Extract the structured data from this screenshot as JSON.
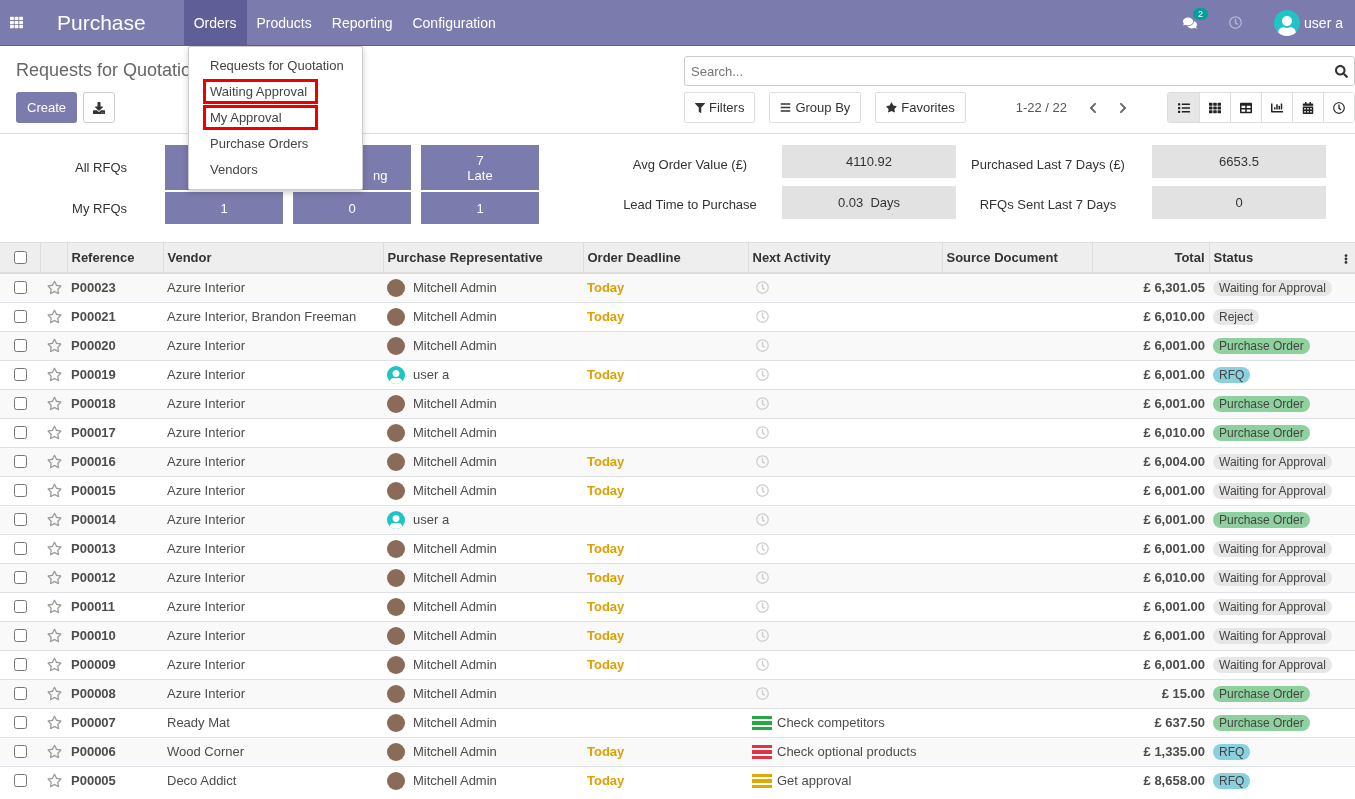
{
  "navbar": {
    "app_title": "Purchase",
    "menu": [
      {
        "label": "Orders",
        "selected": true
      },
      {
        "label": "Products",
        "selected": false
      },
      {
        "label": "Reporting",
        "selected": false
      },
      {
        "label": "Configuration",
        "selected": false
      }
    ],
    "messages_count": "2",
    "user": "user a"
  },
  "orders_menu": [
    {
      "label": "Requests for Quotation",
      "highlighted": false
    },
    {
      "label": "Waiting Approval",
      "highlighted": true
    },
    {
      "label": "My Approval",
      "highlighted": true
    },
    {
      "label": "Purchase Orders",
      "highlighted": false
    },
    {
      "label": "Vendors",
      "highlighted": false
    }
  ],
  "control_panel": {
    "title": "Requests for Quotatio",
    "create": "Create",
    "search": {
      "placeholder": "Search..."
    },
    "filters": "Filters",
    "group_by": "Group By",
    "favorites": "Favorites",
    "pager": "1-22 / 22",
    "views": [
      {
        "kind": "list",
        "selected": true
      },
      {
        "kind": "kanban",
        "selected": false
      },
      {
        "kind": "pivot",
        "selected": false
      },
      {
        "kind": "graph",
        "selected": false
      },
      {
        "kind": "calendar",
        "selected": false
      },
      {
        "kind": "activity",
        "selected": false
      }
    ]
  },
  "dashboard": {
    "row_labels": [
      "All RFQs",
      "My RFQs"
    ],
    "top_tiles": [
      {
        "label": "ng"
      },
      {
        "value": "7",
        "label": "Late"
      }
    ],
    "bottom_tiles": [
      "1",
      "0",
      "1"
    ],
    "stats": [
      {
        "label": "Avg Order Value (£)",
        "value": "4110.92"
      },
      {
        "label": "Purchased Last 7 Days (£)",
        "value": "6653.5"
      },
      {
        "label": "Lead Time to Purchase",
        "value": "0.03  Days"
      },
      {
        "label": "RFQs Sent Last 7 Days",
        "value": "0"
      }
    ]
  },
  "table": {
    "select_all_checked": false,
    "columns": [
      "Reference",
      "Vendor",
      "Purchase Representative",
      "Order Deadline",
      "Next Activity",
      "Source Document",
      "Total",
      "Status"
    ],
    "rows": [
      {
        "checked": false,
        "reference": "P00023",
        "vendor": "Azure Interior",
        "rep": {
          "name": "Mitchell Admin",
          "kind": "photo"
        },
        "deadline": "Today",
        "total": "£ 6,301.05",
        "status": {
          "label": "Waiting for Approval",
          "color": "#e6e6e6"
        }
      },
      {
        "checked": false,
        "reference": "P00021",
        "vendor": "Azure Interior, Brandon Freeman",
        "rep": {
          "name": "Mitchell Admin",
          "kind": "photo"
        },
        "deadline": "Today",
        "total": "£ 6,010.00",
        "status": {
          "label": "Reject",
          "color": "#e6e6e6"
        }
      },
      {
        "checked": false,
        "reference": "P00020",
        "vendor": "Azure Interior",
        "rep": {
          "name": "Mitchell Admin",
          "kind": "photo"
        },
        "total": "£ 6,001.00",
        "status": {
          "label": "Purchase Order",
          "color": "#8fd19e"
        }
      },
      {
        "checked": false,
        "reference": "P00019",
        "vendor": "Azure Interior",
        "rep": {
          "name": "user a",
          "kind": "user"
        },
        "deadline": "Today",
        "total": "£ 6,001.00",
        "status": {
          "label": "RFQ",
          "color": "#8ad0df"
        }
      },
      {
        "checked": false,
        "reference": "P00018",
        "vendor": "Azure Interior",
        "rep": {
          "name": "Mitchell Admin",
          "kind": "photo"
        },
        "total": "£ 6,001.00",
        "status": {
          "label": "Purchase Order",
          "color": "#8fd19e"
        }
      },
      {
        "checked": false,
        "reference": "P00017",
        "vendor": "Azure Interior",
        "rep": {
          "name": "Mitchell Admin",
          "kind": "photo"
        },
        "total": "£ 6,010.00",
        "status": {
          "label": "Purchase Order",
          "color": "#8fd19e"
        }
      },
      {
        "checked": false,
        "reference": "P00016",
        "vendor": "Azure Interior",
        "rep": {
          "name": "Mitchell Admin",
          "kind": "photo"
        },
        "deadline": "Today",
        "total": "£ 6,004.00",
        "status": {
          "label": "Waiting for Approval",
          "color": "#e6e6e6"
        }
      },
      {
        "checked": false,
        "reference": "P00015",
        "vendor": "Azure Interior",
        "rep": {
          "name": "Mitchell Admin",
          "kind": "photo"
        },
        "deadline": "Today",
        "total": "£ 6,001.00",
        "status": {
          "label": "Waiting for Approval",
          "color": "#e6e6e6"
        }
      },
      {
        "checked": false,
        "reference": "P00014",
        "vendor": "Azure Interior",
        "rep": {
          "name": "user a",
          "kind": "user"
        },
        "total": "£ 6,001.00",
        "status": {
          "label": "Purchase Order",
          "color": "#8fd19e"
        }
      },
      {
        "checked": false,
        "reference": "P00013",
        "vendor": "Azure Interior",
        "rep": {
          "name": "Mitchell Admin",
          "kind": "photo"
        },
        "deadline": "Today",
        "total": "£ 6,001.00",
        "status": {
          "label": "Waiting for Approval",
          "color": "#e6e6e6"
        }
      },
      {
        "checked": false,
        "reference": "P00012",
        "vendor": "Azure Interior",
        "rep": {
          "name": "Mitchell Admin",
          "kind": "photo"
        },
        "deadline": "Today",
        "total": "£ 6,010.00",
        "status": {
          "label": "Waiting for Approval",
          "color": "#e6e6e6"
        }
      },
      {
        "checked": false,
        "reference": "P00011",
        "vendor": "Azure Interior",
        "rep": {
          "name": "Mitchell Admin",
          "kind": "photo"
        },
        "deadline": "Today",
        "total": "£ 6,001.00",
        "status": {
          "label": "Waiting for Approval",
          "color": "#e6e6e6"
        }
      },
      {
        "checked": false,
        "reference": "P00010",
        "vendor": "Azure Interior",
        "rep": {
          "name": "Mitchell Admin",
          "kind": "photo"
        },
        "deadline": "Today",
        "total": "£ 6,001.00",
        "status": {
          "label": "Waiting for Approval",
          "color": "#e6e6e6"
        }
      },
      {
        "checked": false,
        "reference": "P00009",
        "vendor": "Azure Interior",
        "rep": {
          "name": "Mitchell Admin",
          "kind": "photo"
        },
        "deadline": "Today",
        "total": "£ 6,001.00",
        "status": {
          "label": "Waiting for Approval",
          "color": "#e6e6e6"
        }
      },
      {
        "checked": false,
        "reference": "P00008",
        "vendor": "Azure Interior",
        "rep": {
          "name": "Mitchell Admin",
          "kind": "photo"
        },
        "total": "£ 15.00",
        "status": {
          "label": "Purchase Order",
          "color": "#8fd19e"
        }
      },
      {
        "checked": false,
        "reference": "P00007",
        "vendor": "Ready Mat",
        "rep": {
          "name": "Mitchell Admin",
          "kind": "photo"
        },
        "activity": {
          "label": "Check competitors",
          "color": "#28a745"
        },
        "total": "£ 637.50",
        "status": {
          "label": "Purchase Order",
          "color": "#8fd19e"
        }
      },
      {
        "checked": false,
        "reference": "P00006",
        "vendor": "Wood Corner",
        "rep": {
          "name": "Mitchell Admin",
          "kind": "photo"
        },
        "deadline": "Today",
        "activity": {
          "label": "Check optional products",
          "color": "#dc3545"
        },
        "total": "£ 1,335.00",
        "status": {
          "label": "RFQ",
          "color": "#8ad0df"
        }
      },
      {
        "checked": false,
        "reference": "P00005",
        "vendor": "Deco Addict",
        "rep": {
          "name": "Mitchell Admin",
          "kind": "photo"
        },
        "deadline": "Today",
        "activity": {
          "label": "Get approval",
          "color": "#e0a800"
        },
        "total": "£ 8,658.00",
        "status": {
          "label": "RFQ",
          "color": "#8ad0df"
        }
      }
    ]
  }
}
